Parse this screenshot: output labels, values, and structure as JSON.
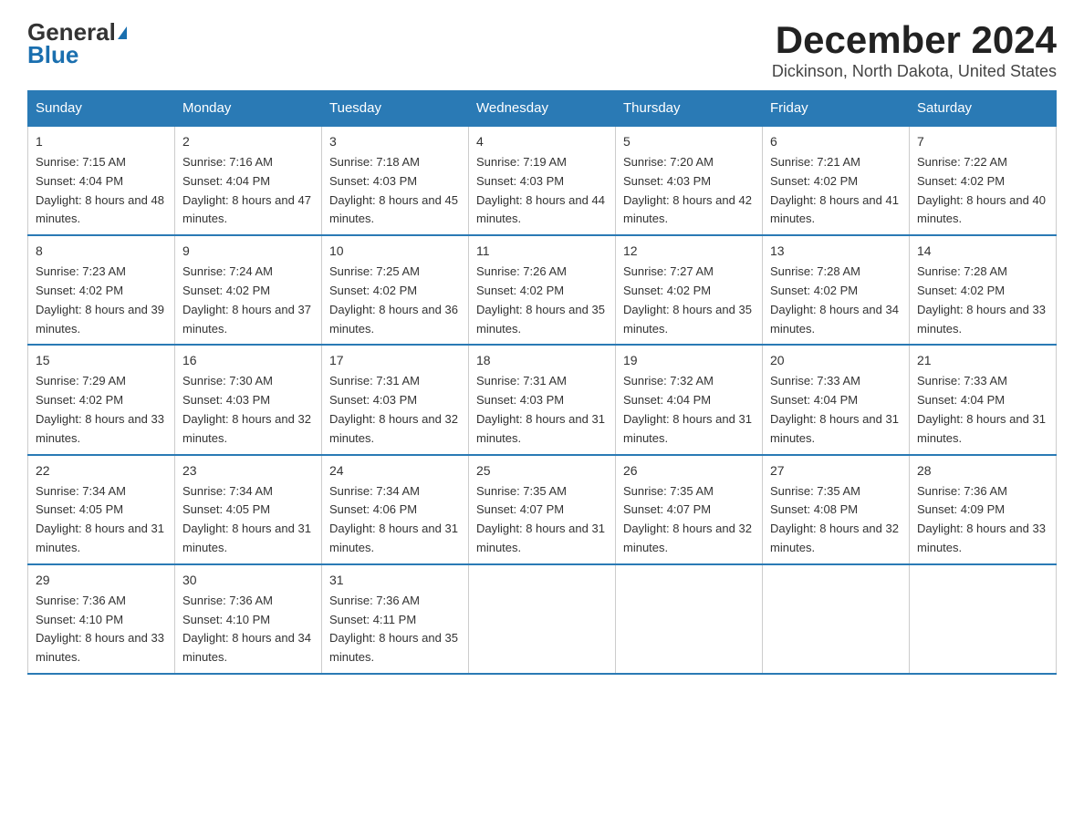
{
  "logo": {
    "text_general": "General",
    "text_blue": "Blue"
  },
  "title": "December 2024",
  "subtitle": "Dickinson, North Dakota, United States",
  "weekdays": [
    "Sunday",
    "Monday",
    "Tuesday",
    "Wednesday",
    "Thursday",
    "Friday",
    "Saturday"
  ],
  "weeks": [
    [
      {
        "day": "1",
        "sunrise": "7:15 AM",
        "sunset": "4:04 PM",
        "daylight": "8 hours and 48 minutes."
      },
      {
        "day": "2",
        "sunrise": "7:16 AM",
        "sunset": "4:04 PM",
        "daylight": "8 hours and 47 minutes."
      },
      {
        "day": "3",
        "sunrise": "7:18 AM",
        "sunset": "4:03 PM",
        "daylight": "8 hours and 45 minutes."
      },
      {
        "day": "4",
        "sunrise": "7:19 AM",
        "sunset": "4:03 PM",
        "daylight": "8 hours and 44 minutes."
      },
      {
        "day": "5",
        "sunrise": "7:20 AM",
        "sunset": "4:03 PM",
        "daylight": "8 hours and 42 minutes."
      },
      {
        "day": "6",
        "sunrise": "7:21 AM",
        "sunset": "4:02 PM",
        "daylight": "8 hours and 41 minutes."
      },
      {
        "day": "7",
        "sunrise": "7:22 AM",
        "sunset": "4:02 PM",
        "daylight": "8 hours and 40 minutes."
      }
    ],
    [
      {
        "day": "8",
        "sunrise": "7:23 AM",
        "sunset": "4:02 PM",
        "daylight": "8 hours and 39 minutes."
      },
      {
        "day": "9",
        "sunrise": "7:24 AM",
        "sunset": "4:02 PM",
        "daylight": "8 hours and 37 minutes."
      },
      {
        "day": "10",
        "sunrise": "7:25 AM",
        "sunset": "4:02 PM",
        "daylight": "8 hours and 36 minutes."
      },
      {
        "day": "11",
        "sunrise": "7:26 AM",
        "sunset": "4:02 PM",
        "daylight": "8 hours and 35 minutes."
      },
      {
        "day": "12",
        "sunrise": "7:27 AM",
        "sunset": "4:02 PM",
        "daylight": "8 hours and 35 minutes."
      },
      {
        "day": "13",
        "sunrise": "7:28 AM",
        "sunset": "4:02 PM",
        "daylight": "8 hours and 34 minutes."
      },
      {
        "day": "14",
        "sunrise": "7:28 AM",
        "sunset": "4:02 PM",
        "daylight": "8 hours and 33 minutes."
      }
    ],
    [
      {
        "day": "15",
        "sunrise": "7:29 AM",
        "sunset": "4:02 PM",
        "daylight": "8 hours and 33 minutes."
      },
      {
        "day": "16",
        "sunrise": "7:30 AM",
        "sunset": "4:03 PM",
        "daylight": "8 hours and 32 minutes."
      },
      {
        "day": "17",
        "sunrise": "7:31 AM",
        "sunset": "4:03 PM",
        "daylight": "8 hours and 32 minutes."
      },
      {
        "day": "18",
        "sunrise": "7:31 AM",
        "sunset": "4:03 PM",
        "daylight": "8 hours and 31 minutes."
      },
      {
        "day": "19",
        "sunrise": "7:32 AM",
        "sunset": "4:04 PM",
        "daylight": "8 hours and 31 minutes."
      },
      {
        "day": "20",
        "sunrise": "7:33 AM",
        "sunset": "4:04 PM",
        "daylight": "8 hours and 31 minutes."
      },
      {
        "day": "21",
        "sunrise": "7:33 AM",
        "sunset": "4:04 PM",
        "daylight": "8 hours and 31 minutes."
      }
    ],
    [
      {
        "day": "22",
        "sunrise": "7:34 AM",
        "sunset": "4:05 PM",
        "daylight": "8 hours and 31 minutes."
      },
      {
        "day": "23",
        "sunrise": "7:34 AM",
        "sunset": "4:05 PM",
        "daylight": "8 hours and 31 minutes."
      },
      {
        "day": "24",
        "sunrise": "7:34 AM",
        "sunset": "4:06 PM",
        "daylight": "8 hours and 31 minutes."
      },
      {
        "day": "25",
        "sunrise": "7:35 AM",
        "sunset": "4:07 PM",
        "daylight": "8 hours and 31 minutes."
      },
      {
        "day": "26",
        "sunrise": "7:35 AM",
        "sunset": "4:07 PM",
        "daylight": "8 hours and 32 minutes."
      },
      {
        "day": "27",
        "sunrise": "7:35 AM",
        "sunset": "4:08 PM",
        "daylight": "8 hours and 32 minutes."
      },
      {
        "day": "28",
        "sunrise": "7:36 AM",
        "sunset": "4:09 PM",
        "daylight": "8 hours and 33 minutes."
      }
    ],
    [
      {
        "day": "29",
        "sunrise": "7:36 AM",
        "sunset": "4:10 PM",
        "daylight": "8 hours and 33 minutes."
      },
      {
        "day": "30",
        "sunrise": "7:36 AM",
        "sunset": "4:10 PM",
        "daylight": "8 hours and 34 minutes."
      },
      {
        "day": "31",
        "sunrise": "7:36 AM",
        "sunset": "4:11 PM",
        "daylight": "8 hours and 35 minutes."
      },
      null,
      null,
      null,
      null
    ]
  ]
}
